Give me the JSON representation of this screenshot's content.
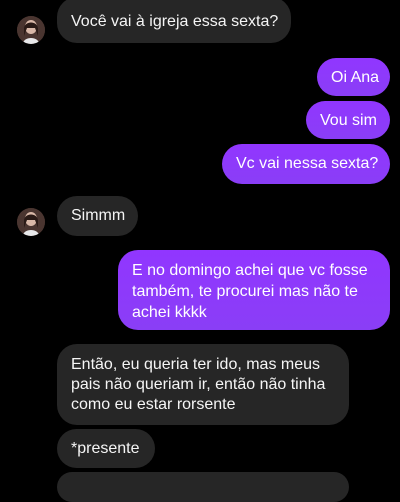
{
  "contact": {
    "avatar_icon": "contact-photo-avatar"
  },
  "colors": {
    "background": "#000000",
    "incoming_bubble": "#262626",
    "outgoing_bubble": "#8a3dff",
    "text": "#ffffff"
  },
  "messages": [
    {
      "direction": "incoming",
      "text": "Você vai à igreja essa sexta?"
    },
    {
      "direction": "outgoing",
      "text": "Oi Ana"
    },
    {
      "direction": "outgoing",
      "text": "Vou sim"
    },
    {
      "direction": "outgoing",
      "text": "Vc vai nessa sexta?"
    },
    {
      "direction": "incoming",
      "text": "Simmm"
    },
    {
      "direction": "outgoing",
      "text": "E no domingo achei que vc fosse também, te procurei mas não te achei kkkk"
    },
    {
      "direction": "incoming",
      "text": "Então, eu queria ter ido, mas meus pais não queriam ir, então não tinha como eu estar rorsente"
    },
    {
      "direction": "incoming",
      "text": "*presente"
    }
  ]
}
